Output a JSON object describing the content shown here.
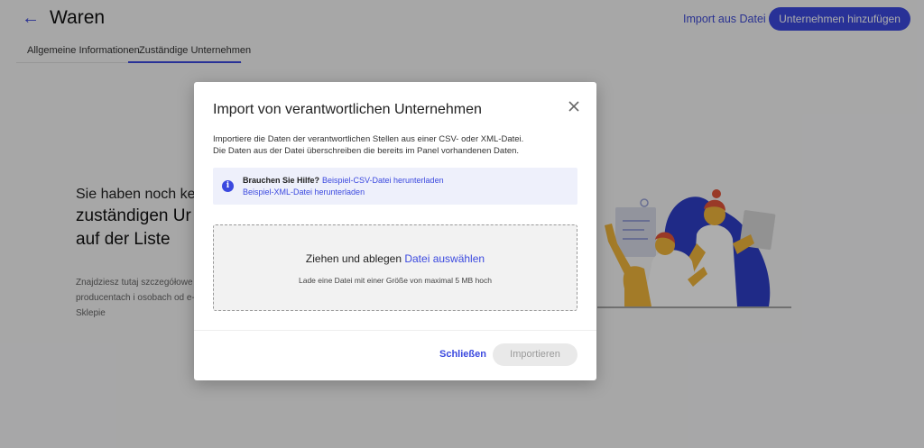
{
  "header": {
    "title": "Waren",
    "import_link": "Import aus Datei",
    "add_button": "Unternehmen hinzufügen"
  },
  "tabs": [
    {
      "label": "Allgemeine Informationen",
      "active": false
    },
    {
      "label": "Zuständige Unternehmen",
      "active": true
    }
  ],
  "empty_state": {
    "line1": "Sie haben noch kein",
    "line2": "zuständigen Ur",
    "line3": "auf der Liste",
    "description": "Znajdziesz tutaj szczegółowe o producentach i osobach od e-Sklepie"
  },
  "modal": {
    "title": "Import von verantwortlichen Unternehmen",
    "text_line1": "Importiere die Daten der verantwortlichen Stellen aus einer CSV- oder XML-Datei.",
    "text_line2": "Die Daten aus der Datei überschreiben die bereits im Panel vorhandenen Daten.",
    "help": {
      "label": "Brauchen Sie Hilfe?",
      "csv_link": "Beispiel-CSV-Datei herunterladen",
      "xml_link": "Beispiel-XML-Datei herunterladen"
    },
    "dropzone": {
      "prefix": "Ziehen und ablegen ",
      "link": "Datei auswählen",
      "hint": "Lade eine Datei mit einer Größe von maximal 5 MB hoch"
    },
    "close_button": "Schließen",
    "import_button": "Importieren"
  },
  "colors": {
    "accent": "#3b49df",
    "overlay": "rgba(0,0,0,0.32)"
  },
  "icons": [
    "back-arrow-icon",
    "close-icon",
    "info-icon"
  ]
}
